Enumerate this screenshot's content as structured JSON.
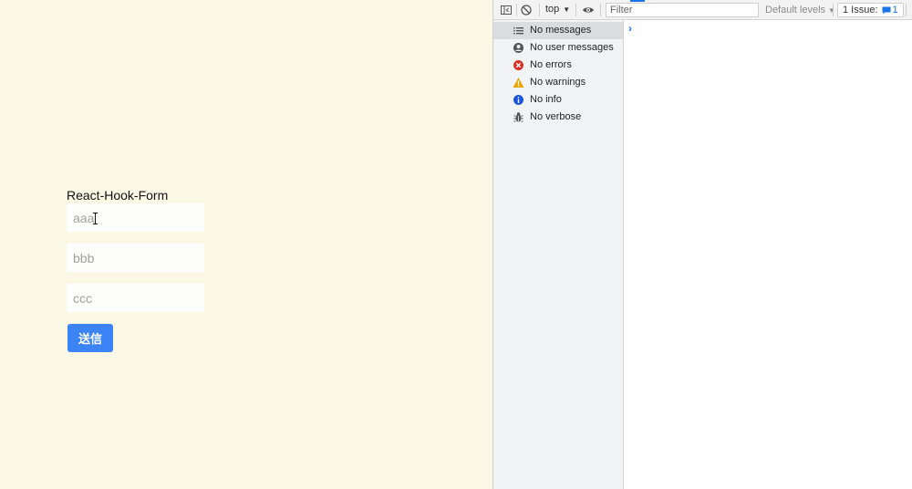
{
  "app": {
    "form_title": "React-Hook-Form",
    "fields": [
      {
        "value": "",
        "placeholder": "aaa"
      },
      {
        "value": "",
        "placeholder": "bbb"
      },
      {
        "value": "",
        "placeholder": "ccc"
      }
    ],
    "submit_label": "送信",
    "colors": {
      "background": "#fbf8e6",
      "button": "#3c83f6"
    }
  },
  "devtools": {
    "toolbar": {
      "context": "top",
      "filter_placeholder": "Filter",
      "levels": "Default levels",
      "issues_label": "1 Issue:",
      "issues_count": "1"
    },
    "sidebar": [
      {
        "label": "No messages",
        "icon": "list-icon",
        "selected": true
      },
      {
        "label": "No user messages",
        "icon": "user-icon"
      },
      {
        "label": "No errors",
        "icon": "error-icon"
      },
      {
        "label": "No warnings",
        "icon": "warning-icon"
      },
      {
        "label": "No info",
        "icon": "info-icon"
      },
      {
        "label": "No verbose",
        "icon": "bug-icon"
      }
    ],
    "prompt": "›"
  }
}
